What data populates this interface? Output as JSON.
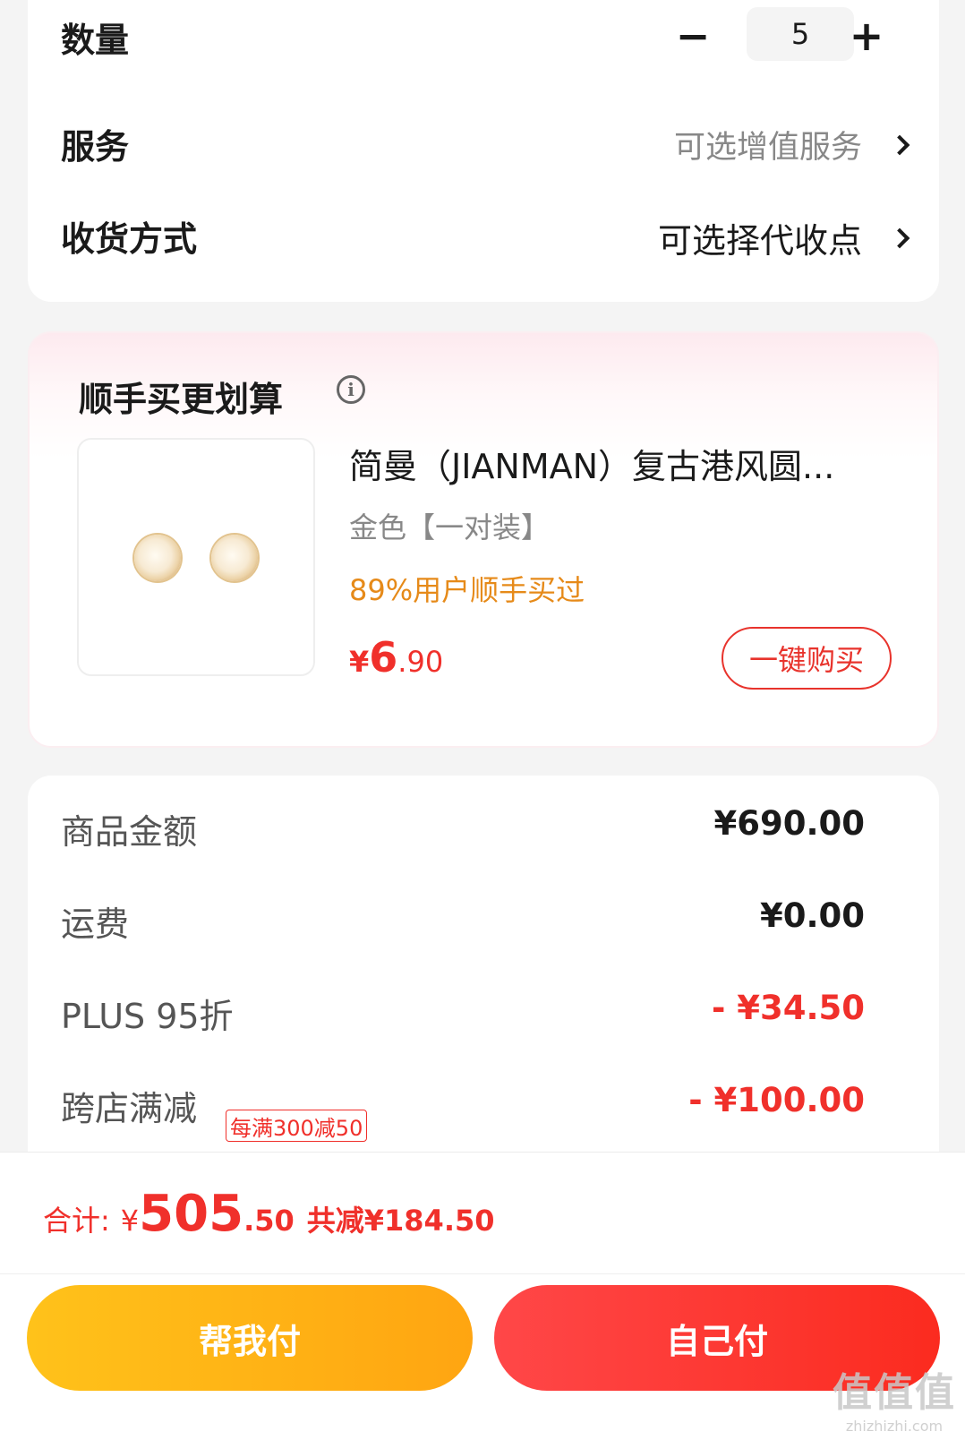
{
  "quantity": {
    "label": "数量",
    "minus": "−",
    "value": "5",
    "plus": "+"
  },
  "service": {
    "label": "服务",
    "value": "可选增值服务"
  },
  "delivery": {
    "label": "收货方式",
    "value": "可选择代收点"
  },
  "recommend": {
    "title": "顺手买更划算",
    "product": {
      "name": "简曼（JIANMAN）复古港风圆...",
      "spec": "金色【一对装】",
      "hint": "89%用户顺手买过",
      "price_currency": "¥",
      "price_int": "6",
      "price_dec": ".90",
      "buy_label": "一键购买"
    }
  },
  "summary": {
    "rows": [
      {
        "label": "商品金额",
        "value": "¥690.00"
      },
      {
        "label": "运费",
        "value": "¥0.00"
      },
      {
        "label": "PLUS 95折",
        "value": "- ¥34.50"
      },
      {
        "label": "跨店满减",
        "value": "- ¥100.00",
        "tag": "每满300减50"
      }
    ]
  },
  "footer": {
    "total_label": "合计:",
    "total_currency": "¥",
    "total_int": "505",
    "total_dec": ".50",
    "saved": "共减¥184.50",
    "pay_for_me": "帮我付",
    "pay_self": "自己付"
  },
  "watermark": {
    "text": "值值值",
    "url": "zhizhizhi.com"
  },
  "colors": {
    "accent_red": "#f0302b",
    "accent_orange": "#e68a19",
    "pay_yellow": "#ffb116"
  }
}
